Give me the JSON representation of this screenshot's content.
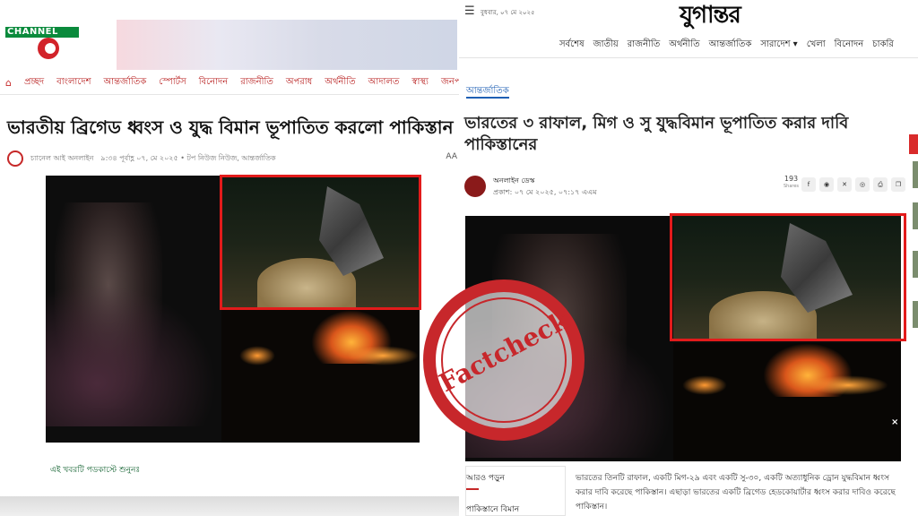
{
  "left_site": {
    "logo_text": "CHANNEL",
    "nav": [
      "প্রচ্ছদ",
      "বাংলাদেশ",
      "আন্তর্জাতিক",
      "স্পোর্টস",
      "বিনোদন",
      "রাজনীতি",
      "অপরাধ",
      "অর্থনীতি",
      "আদালত",
      "স্বাস্থ্য",
      "জনপদ"
    ],
    "headline": "ভারতীয় ব্রিগেড ধ্বংস ও যুদ্ধ বিমান ভূপাতিত করলো পাকিস্তান",
    "byline_author": "চ্যানেল আই অনলাইন",
    "byline_meta": "৯:৩৪ পূর্বাহ্ণ ০৭, মে ২০২৫ • টপ নিউজ নিউজ, আন্তর্জাতিক",
    "font_size_label": "AA",
    "listen_text": "এই খবরটি পডকাস্টে শুনুনঃ"
  },
  "right_site": {
    "date": "বুধবার, ০৭ মে ২০২৫",
    "logo": "যুগান্তর",
    "nav": [
      "সর্বশেষ",
      "জাতীয়",
      "রাজনীতি",
      "অর্থনীতি",
      "আন্তর্জাতিক",
      "সারাদেশ ▾",
      "খেলা",
      "বিনোদন",
      "চাকরি"
    ],
    "category": "আন্তর্জাতিক",
    "headline": "ভারতের ৩ রাফাল, মিগ ও সু যুদ্ধবিমান ভূপাতিত করার দাবি পাকিস্তানের",
    "author": "অনলাইন ডেস্ক",
    "published": "প্রকাশ: ০৭ মে ২০২৫, ০৭:১৭ এএম",
    "share_count": "193",
    "share_label": "Shares",
    "share_icons": [
      "f",
      "m",
      "x",
      "w",
      "p",
      "c"
    ],
    "close_label": "×",
    "more_label": "আরও পড়ুন",
    "more_item": "পাকিস্তানে বিমান",
    "body": "ভারতের তিনটি রাফাল, একটি মিগ-২৯ এবং একটি সু-৩০, একটি অত্যাধুনিক ড্রোন যুদ্ধবিমান ধ্বংস করার দাবি করেছে পাকিস্তান। এছাড়া ভারতের একটি ব্রিগেড হেডকোয়ার্টার ধ্বংস করার দাবিও করেছে পাকিস্তান।"
  },
  "stamp": {
    "text": "Factcheck",
    "color": "#c7272b"
  },
  "colors": {
    "highlight_box": "#e21b1b",
    "left_nav": "#b71c1c",
    "right_category": "#1e5fb4"
  }
}
